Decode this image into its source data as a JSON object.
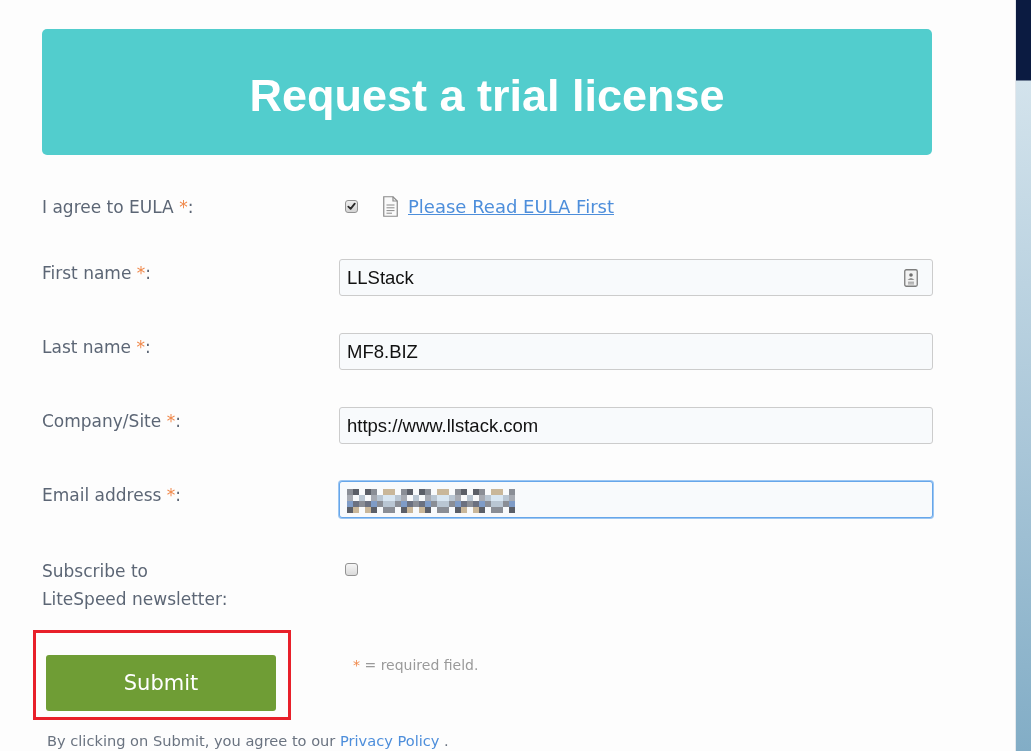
{
  "banner": {
    "title": "Request a trial license"
  },
  "fields": [
    {
      "kind": "checkbox-link",
      "label": "I agree to EULA",
      "required_mark": "*",
      "suffix": ":",
      "checked": true,
      "link": "Please Read EULA First"
    },
    {
      "kind": "text",
      "label": "First name",
      "required_mark": "*",
      "suffix": ":",
      "value": "LLStack",
      "obscured": false,
      "autofill_icon": true,
      "focused": false
    },
    {
      "kind": "text",
      "label": "Last name",
      "required_mark": "*",
      "suffix": ":",
      "value": "MF8.BIZ",
      "obscured": false,
      "autofill_icon": false,
      "focused": false
    },
    {
      "kind": "text",
      "label": "Company/Site",
      "required_mark": "*",
      "suffix": ":",
      "value": "https://www.llstack.com",
      "obscured": false,
      "autofill_icon": false,
      "focused": false
    },
    {
      "kind": "text",
      "label": "Email address",
      "required_mark": "*",
      "suffix": ":",
      "obscured": true,
      "autofill_icon": false,
      "focused": true
    },
    {
      "kind": "checkbox",
      "label": "Subscribe to LiteSpeed newsletter",
      "suffix": ":",
      "checked": false
    }
  ],
  "submit": {
    "label": "Submit",
    "highlighted": true
  },
  "required_note": {
    "mark": "*",
    "text": "= required field."
  },
  "privacy_notice": {
    "text": "By clicking on Submit, you agree to our",
    "link": "Privacy Policy",
    "end": "."
  }
}
